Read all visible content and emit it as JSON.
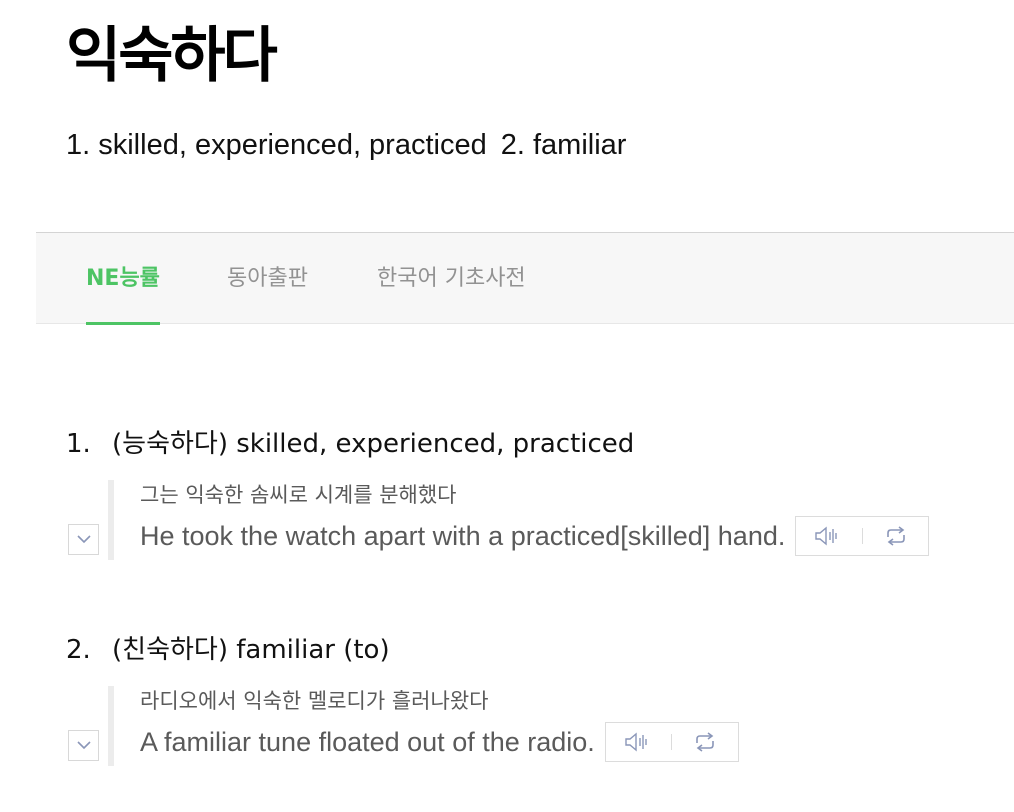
{
  "entry": {
    "headword": "익숙하다",
    "summary": {
      "item1": "1. skilled, experienced, practiced",
      "item2": "2. familiar"
    }
  },
  "tabs": [
    {
      "label": "NE능률",
      "active": true
    },
    {
      "label": "동아출판",
      "active": false
    },
    {
      "label": "한국어 기초사전",
      "active": false
    }
  ],
  "senses": [
    {
      "number": "1.",
      "definition": "(능숙하다) skilled, experienced, practiced",
      "example_ko": "그는 익숙한 솜씨로 시계를 분해했다",
      "example_en": "He took the watch apart with a practiced[skilled] hand."
    },
    {
      "number": "2.",
      "definition": "(친숙하다) familiar (to)",
      "example_ko": "라디오에서 익숙한 멜로디가 흘러나왔다",
      "example_en": "A familiar tune floated out of the radio."
    }
  ],
  "icons": {
    "speaker": "speaker-icon",
    "repeat": "repeat-icon",
    "expand": "chevron-down-icon"
  },
  "colors": {
    "accent": "#4dc464",
    "tab_inactive": "#929292",
    "example_text": "#5a5a5a",
    "icon": "#8a96b8"
  }
}
